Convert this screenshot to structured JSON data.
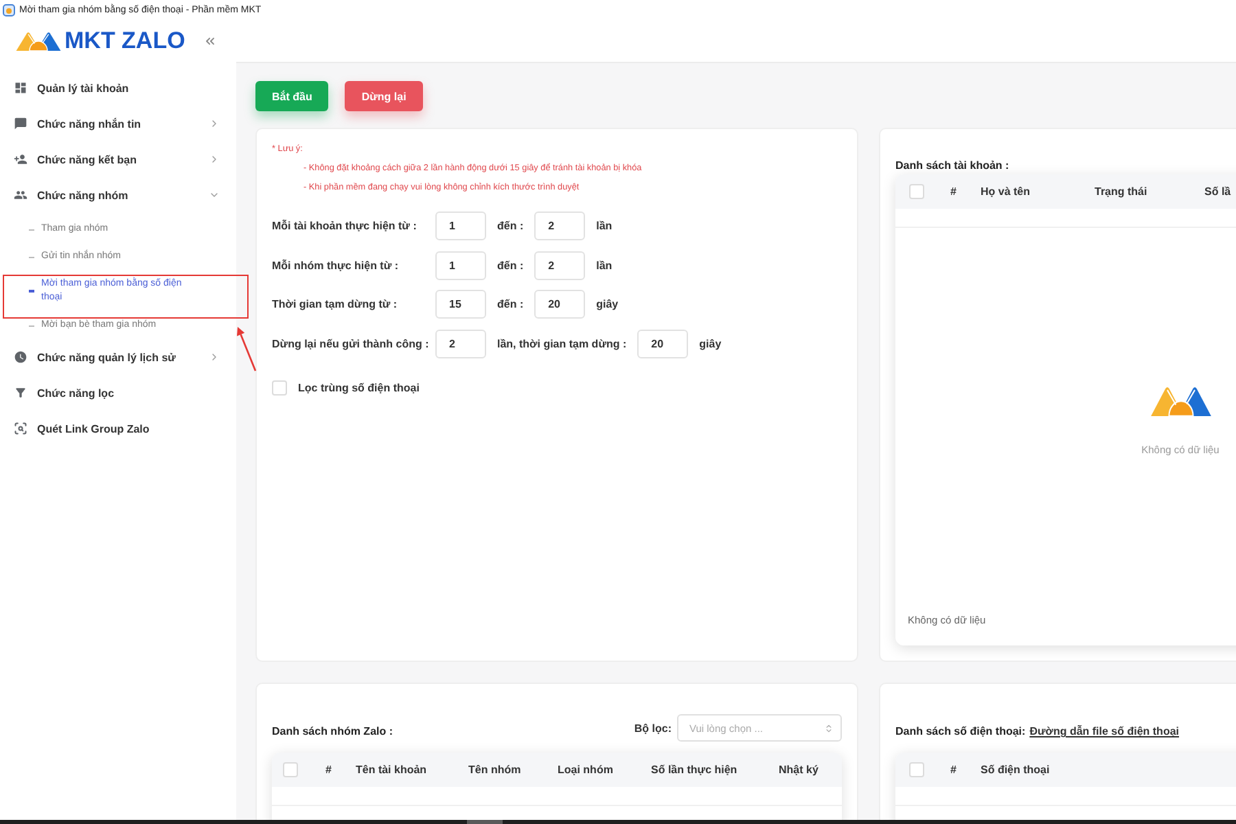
{
  "window": {
    "title": "Mời tham gia nhóm bằng số điện thoại - Phần mềm MKT"
  },
  "sidebar": {
    "brand": "MKT ZALO",
    "items": [
      {
        "label": "Quản lý tài khoản",
        "selected": false
      },
      {
        "label": "Chức năng nhắn tin",
        "selected": false,
        "expanded": false
      },
      {
        "label": "Chức năng kết bạn",
        "selected": false,
        "expanded": false
      },
      {
        "label": "Chức năng nhóm",
        "selected": false,
        "expanded": true,
        "children": [
          {
            "label": "Tham gia nhóm",
            "selected": false,
            "highlighted": false
          },
          {
            "label": "Gửi tin nhắn nhóm",
            "selected": false,
            "highlighted": false
          },
          {
            "label": "Mời tham gia nhóm bằng số điện thoại",
            "selected": true,
            "highlighted": true
          },
          {
            "label": "Mời bạn bè tham gia nhóm",
            "selected": false,
            "highlighted": false
          }
        ]
      },
      {
        "label": "Chức năng quản lý lịch sử",
        "selected": false,
        "expanded": false
      },
      {
        "label": "Chức năng lọc",
        "selected": false
      },
      {
        "label": "Quét Link Group Zalo",
        "selected": false
      }
    ]
  },
  "toolbar": {
    "buttons": [
      {
        "label": "Bắt đầu",
        "kind": "start"
      },
      {
        "label": "Dừng lại",
        "kind": "stop"
      }
    ]
  },
  "settings": {
    "note_title": "* Lưu ý:",
    "notes": [
      "- Không đặt khoảng cách giữa 2 lần hành động dưới 15 giây để tránh tài khoản bị khóa",
      "- Khi phần mềm đang chạy vui lòng không chỉnh kích thước trình duyệt"
    ],
    "rows": [
      {
        "label": "Mỗi tài khoản thực hiện từ :",
        "parts": [
          {
            "kind": "input",
            "value": "1"
          },
          {
            "kind": "text",
            "text": "đến :"
          },
          {
            "kind": "input",
            "value": "2"
          },
          {
            "kind": "text",
            "text": "lần"
          }
        ]
      },
      {
        "label": "Mỗi nhóm thực hiện từ :",
        "parts": [
          {
            "kind": "input",
            "value": "1"
          },
          {
            "kind": "text",
            "text": "đến :"
          },
          {
            "kind": "input",
            "value": "2"
          },
          {
            "kind": "text",
            "text": "lần"
          }
        ]
      },
      {
        "label": "Thời gian tạm dừng từ :",
        "parts": [
          {
            "kind": "input",
            "value": "15"
          },
          {
            "kind": "text",
            "text": "đến :"
          },
          {
            "kind": "input",
            "value": "20"
          },
          {
            "kind": "text",
            "text": "giây"
          }
        ]
      },
      {
        "label": "Dừng lại nếu gửi thành công :",
        "parts": [
          {
            "kind": "input",
            "value": "2"
          },
          {
            "kind": "text",
            "text": "lần, thời gian tạm dừng :"
          },
          {
            "kind": "input",
            "value": "20"
          },
          {
            "kind": "text",
            "text": "giây"
          }
        ]
      }
    ],
    "filter_duplicates": {
      "label": "Lọc trùng số điện thoại",
      "checked": false
    }
  },
  "accounts": {
    "title": "Danh sách tài khoản :",
    "select_all_checked": false,
    "columns": [
      "#",
      "Họ và tên",
      "Trạng thái",
      "Số lầ"
    ],
    "empty_text": "Không có dữ liệu",
    "footer": "Không có dữ liệu"
  },
  "groups": {
    "title": "Danh sách nhóm Zalo :",
    "filter": {
      "label": "Bộ lọc:",
      "placeholder": "Vui lòng chọn ..."
    },
    "select_all_checked": false,
    "columns": [
      "#",
      "Tên tài khoản",
      "Tên nhóm",
      "Loại nhóm",
      "Số lần thực hiện",
      "Nhật ký"
    ]
  },
  "phones": {
    "title": "Danh sách số điện thoại:",
    "link": "Đường dẫn file số điện thoại",
    "select_all_checked": false,
    "columns": [
      "#",
      "Số điện thoại"
    ]
  }
}
